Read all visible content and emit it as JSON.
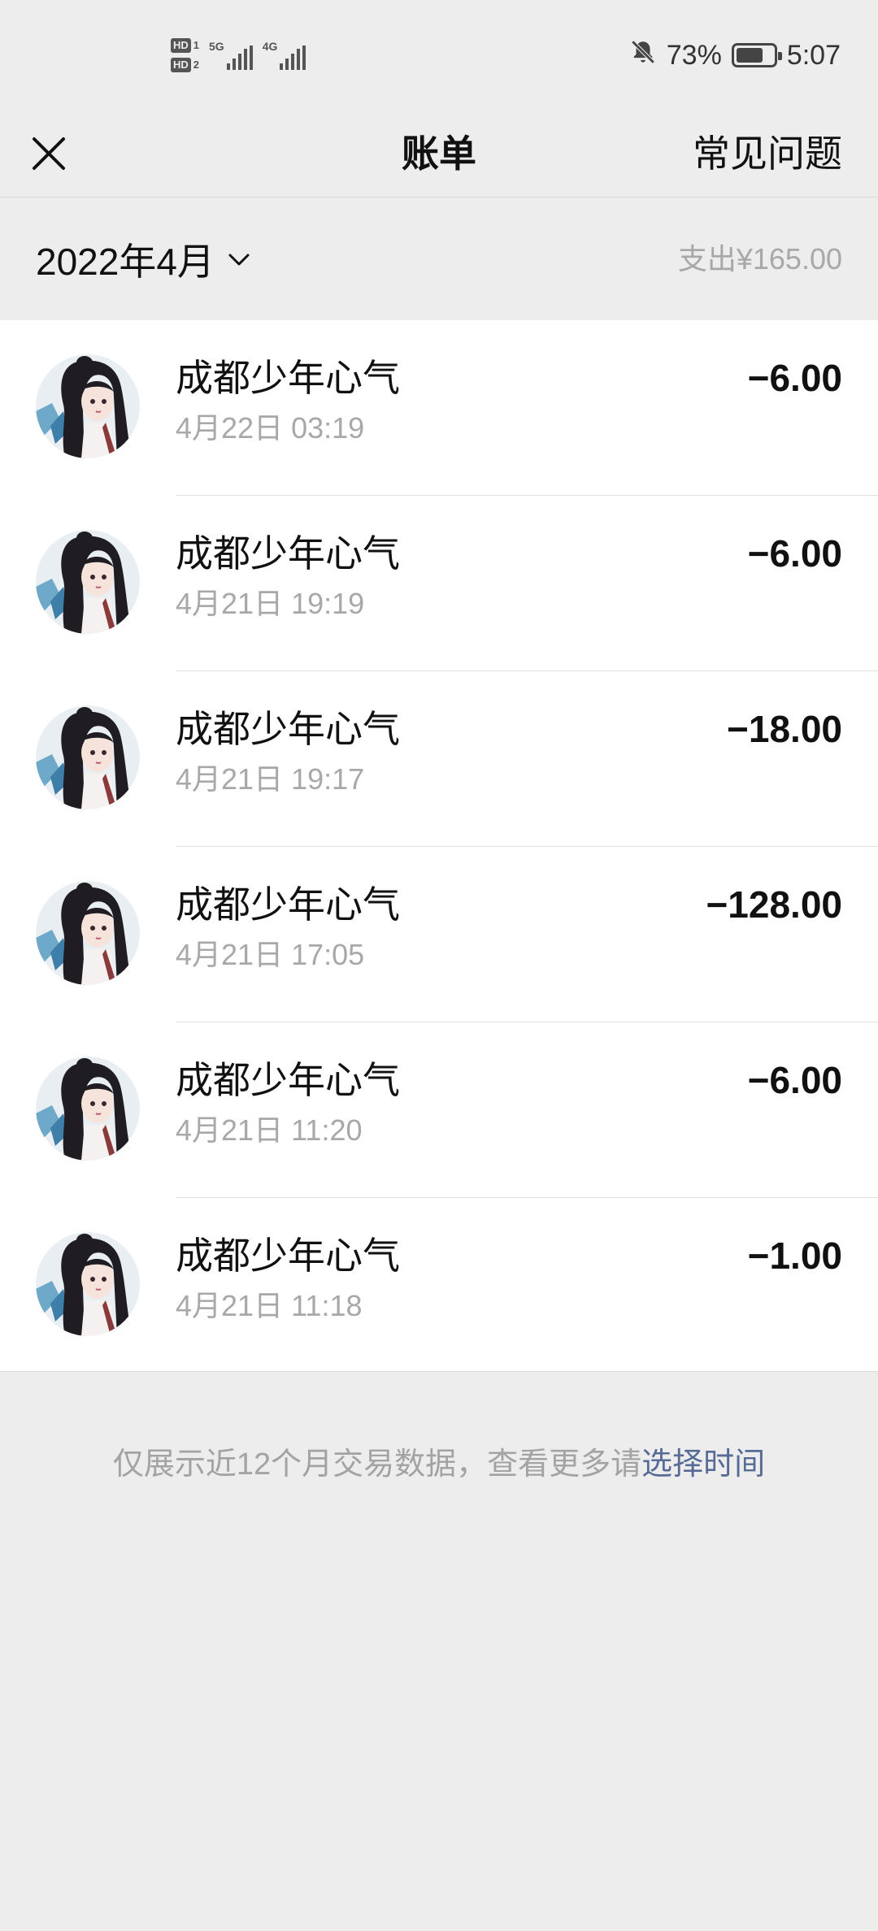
{
  "status_bar": {
    "hd1": "HD",
    "sim1": "1",
    "hd2": "HD",
    "sim2": "2",
    "net1": "5G",
    "net2": "4G",
    "battery_percent": "73%",
    "battery_level": 0.73,
    "time": "5:07",
    "icons": [
      "mute-bell-icon",
      "battery-icon",
      "signal-icon"
    ]
  },
  "header": {
    "close_icon": "close-icon",
    "title": "账单",
    "faq_label": "常见问题"
  },
  "month_bar": {
    "month_label": "2022年4月",
    "dropdown_icon": "chevron-down-icon",
    "expense_summary": "支出¥165.00"
  },
  "transactions": [
    {
      "merchant": "成都少年心气",
      "time": "4月22日 03:19",
      "amount": "−6.00"
    },
    {
      "merchant": "成都少年心气",
      "time": "4月21日 19:19",
      "amount": "−6.00"
    },
    {
      "merchant": "成都少年心气",
      "time": "4月21日 19:17",
      "amount": "−18.00"
    },
    {
      "merchant": "成都少年心气",
      "time": "4月21日 17:05",
      "amount": "−128.00"
    },
    {
      "merchant": "成都少年心气",
      "time": "4月21日 11:20",
      "amount": "−6.00"
    },
    {
      "merchant": "成都少年心气",
      "time": "4月21日 11:18",
      "amount": "−1.00"
    }
  ],
  "footer": {
    "note_prefix": "仅展示近12个月交易数据，查看更多请",
    "note_link": "选择时间"
  },
  "colors": {
    "background": "#ededed",
    "list_background": "#ffffff",
    "secondary_text": "#a8a8a8",
    "link": "#576b95"
  }
}
